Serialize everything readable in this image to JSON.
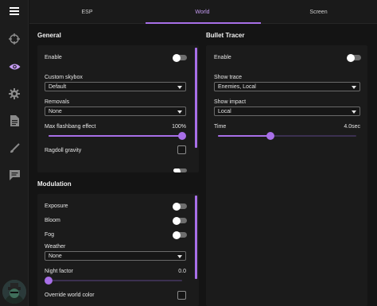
{
  "tabs": [
    {
      "label": "ESP"
    },
    {
      "label": "World"
    },
    {
      "label": "Screen"
    }
  ],
  "active_tab": "World",
  "accent_color": "#a86fe8",
  "sidebar": {
    "icons": [
      "crosshair-icon",
      "eye-icon",
      "gear-icon",
      "document-icon",
      "brush-icon",
      "chat-icon"
    ],
    "active_icon": "eye-icon"
  },
  "general": {
    "title": "General",
    "enable_label": "Enable",
    "enable_on": false,
    "skybox_label": "Custom skybox",
    "skybox_value": "Default",
    "removals_label": "Removals",
    "removals_value": "None",
    "flashbang_label": "Max flashbang effect",
    "flashbang_value": "100%",
    "flashbang_fraction": 1.0,
    "ragdoll_label": "Ragdoll gravity",
    "ragdoll_checked": false
  },
  "modulation": {
    "title": "Modulation",
    "exposure_label": "Exposure",
    "bloom_label": "Bloom",
    "fog_label": "Fog",
    "weather_label": "Weather",
    "weather_value": "None",
    "night_label": "Night factor",
    "night_value": "0.0",
    "night_fraction": 0.0,
    "override_label": "Override world color",
    "override_checked": false
  },
  "bullet_tracer": {
    "title": "Bullet Tracer",
    "enable_label": "Enable",
    "enable_on": false,
    "show_trace_label": "Show trace",
    "show_trace_value": "Enemies, Local",
    "show_impact_label": "Show impact",
    "show_impact_value": "Local",
    "time_label": "Time",
    "time_value": "4.0sec",
    "time_fraction": 0.38
  }
}
